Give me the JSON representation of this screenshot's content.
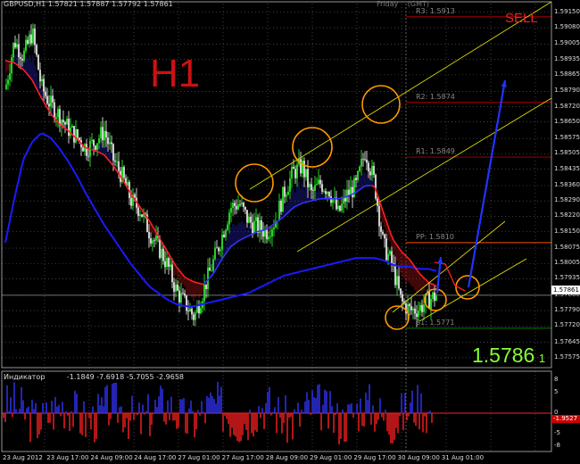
{
  "header": {
    "symbol": "GBPUSD,H1",
    "ohlc": "1.57821 1.57887 1.57792 1.57861",
    "day": "Friday",
    "timezone": "(GMT)"
  },
  "annotations": {
    "timeframe": "H1",
    "signal": "SELL",
    "big_price_main": "1.5786",
    "big_price_small": "1"
  },
  "pivots": [
    {
      "label": "R3:",
      "value": "1.5913",
      "price": 1.5913
    },
    {
      "label": "R2:",
      "value": "1.5874",
      "price": 1.5874
    },
    {
      "label": "R1:",
      "value": "1.5849",
      "price": 1.5849
    },
    {
      "label": "PP:",
      "value": "1.5810",
      "price": 1.581
    },
    {
      "label": "S1:",
      "value": "1.5771",
      "price": 1.5771
    }
  ],
  "current_price": "1.57861",
  "indicator": {
    "title": "Индикатор",
    "values": "-1.1849 -7.6918 -5.7055 -2.9658",
    "ticks": [
      "8",
      "5",
      "0",
      "-5",
      "-8"
    ],
    "tick_values": [
      8,
      5,
      0,
      -5,
      -8
    ],
    "current": "-1.9527"
  },
  "chart_data": {
    "type": "candlestick",
    "symbol": "GBPUSD",
    "timeframe": "H1",
    "ylim": [
      1.5753,
      1.5919
    ],
    "y_ticks": [
      "1.59150",
      "1.59080",
      "1.59005",
      "1.58935",
      "1.58865",
      "1.58790",
      "1.58720",
      "1.58650",
      "1.58575",
      "1.58505",
      "1.58435",
      "1.58360",
      "1.58290",
      "1.58220",
      "1.58150",
      "1.58075",
      "1.58005",
      "1.57935",
      "1.57860",
      "1.57790",
      "1.57720",
      "1.57645",
      "1.57575"
    ],
    "y_tick_values": [
      1.5915,
      1.5908,
      1.59005,
      1.58935,
      1.58865,
      1.5879,
      1.5872,
      1.5865,
      1.58575,
      1.58505,
      1.58435,
      1.5836,
      1.5829,
      1.5822,
      1.5815,
      1.58075,
      1.58005,
      1.57935,
      1.5786,
      1.5779,
      1.5772,
      1.57645,
      1.57575
    ],
    "x_ticks": [
      "23 Aug 2012",
      "23 Aug 17:00",
      "24 Aug 09:00",
      "24 Aug 17:00",
      "27 Aug 01:00",
      "27 Aug 17:00",
      "28 Aug 09:00",
      "29 Aug 01:00",
      "29 Aug 17:00",
      "30 Aug 09:00",
      "31 Aug 01:00"
    ],
    "x_tick_pos": [
      0.0,
      0.087,
      0.174,
      0.26,
      0.347,
      0.434,
      0.521,
      0.608,
      0.695,
      0.782,
      0.869
    ],
    "close_path": [
      1.588,
      1.5902,
      1.5895,
      1.5906,
      1.5881,
      1.5873,
      1.5868,
      1.5862,
      1.5858,
      1.5853,
      1.5856,
      1.5861,
      1.5848,
      1.584,
      1.5829,
      1.5825,
      1.5815,
      1.5808,
      1.58,
      1.5788,
      1.5782,
      1.5776,
      1.5788,
      1.58,
      1.5812,
      1.5826,
      1.5828,
      1.582,
      1.5817,
      1.5815,
      1.582,
      1.5833,
      1.5842,
      1.5845,
      1.5832,
      1.5837,
      1.5834,
      1.5823,
      1.5832,
      1.5836,
      1.5852,
      1.5838,
      1.5809,
      1.58,
      1.5783,
      1.5779,
      1.578,
      1.5784,
      1.5786
    ],
    "ma_fast": [
      1.5893,
      1.5892,
      1.5889,
      1.5884,
      1.5876,
      1.5869,
      1.5864,
      1.5861,
      1.5857,
      1.5853,
      1.5852,
      1.585,
      1.5845,
      1.5839,
      1.5832,
      1.5826,
      1.582,
      1.5813,
      1.5806,
      1.5799,
      1.5794,
      1.5792,
      1.5791,
      1.5795,
      1.5802,
      1.5808,
      1.5811,
      1.5813,
      1.5815,
      1.5816,
      1.5819,
      1.5822,
      1.5826,
      1.5828,
      1.5829,
      1.583,
      1.583,
      1.583,
      1.5831,
      1.5833,
      1.5836,
      1.5836,
      1.5824,
      1.5812,
      1.5806,
      1.5802,
      1.5796,
      1.5792,
      1.579
    ],
    "ma_slow": [
      1.581,
      1.583,
      1.5848,
      1.5856,
      1.586,
      1.5858,
      1.5853,
      1.5847,
      1.584,
      1.5832,
      1.5825,
      1.5818,
      1.5812,
      1.5806,
      1.58,
      1.5795,
      1.579,
      1.5787,
      1.5784,
      1.5782,
      1.5781,
      1.5781,
      1.5782,
      1.5783,
      1.5784,
      1.5785,
      1.5786,
      1.5787,
      1.5789,
      1.5791,
      1.5793,
      1.5795,
      1.5796,
      1.5797,
      1.5798,
      1.5799,
      1.58,
      1.5801,
      1.5802,
      1.5803,
      1.5803,
      1.5803,
      1.5802,
      1.58,
      1.5799,
      1.5799,
      1.5798,
      1.5798,
      1.5797
    ]
  },
  "colors": {
    "background": "#000000",
    "bull_candle": "#33ff33",
    "bear_candle": "#ffffff",
    "ma_fast_up": "#3333ff",
    "ma_fast_down": "#ff2020",
    "ma_slow": "#1a1aff",
    "pivot_line": "#880000",
    "pp_line": "#cc4400",
    "s1_line": "#006600",
    "channel": "#dddd00",
    "circle": "#ff9900",
    "arrow": "#2233ff",
    "grid": "#666666"
  }
}
